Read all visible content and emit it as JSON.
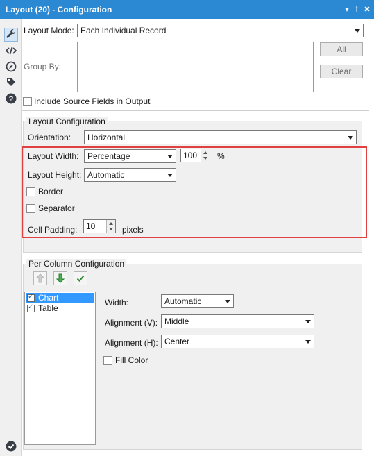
{
  "window": {
    "title": "Layout (20) - Configuration",
    "controls": {
      "dropdown": "▾",
      "pin": "†",
      "close": "✖"
    }
  },
  "leftbar": {
    "dots": "···",
    "icons": [
      "wrench-icon",
      "code-icon",
      "compass-icon",
      "tag-icon",
      "help-icon"
    ],
    "bottom_icon": "checkmark-circle-icon"
  },
  "layout_mode": {
    "label": "Layout Mode:",
    "value": "Each Individual Record"
  },
  "group_by": {
    "label": "Group By:",
    "all_button": "All",
    "clear_button": "Clear"
  },
  "include_source": {
    "label": "Include Source Fields in Output",
    "checked": false
  },
  "layout_config": {
    "title": "Layout Configuration",
    "orientation": {
      "label": "Orientation:",
      "value": "Horizontal"
    },
    "width": {
      "label": "Layout Width:",
      "mode": "Percentage",
      "value": "100",
      "unit": "%"
    },
    "height": {
      "label": "Layout Height:",
      "mode": "Automatic"
    },
    "border": {
      "label": "Border",
      "checked": false
    },
    "separator": {
      "label": "Separator",
      "checked": false
    },
    "cell_padding": {
      "label": "Cell Padding:",
      "value": "10",
      "unit": "pixels"
    }
  },
  "per_column": {
    "title": "Per Column Configuration",
    "items": [
      {
        "label": "Chart",
        "checked": true,
        "selected": true
      },
      {
        "label": "Table",
        "checked": true,
        "selected": false
      }
    ],
    "width": {
      "label": "Width:",
      "value": "Automatic"
    },
    "align_v": {
      "label": "Alignment (V):",
      "value": "Middle"
    },
    "align_h": {
      "label": "Alignment (H):",
      "value": "Center"
    },
    "fill_color": {
      "label": "Fill Color",
      "checked": false
    }
  },
  "colors": {
    "titlebar": "#2b88d2",
    "highlight": "#e0403f",
    "selection": "#3399ff"
  }
}
